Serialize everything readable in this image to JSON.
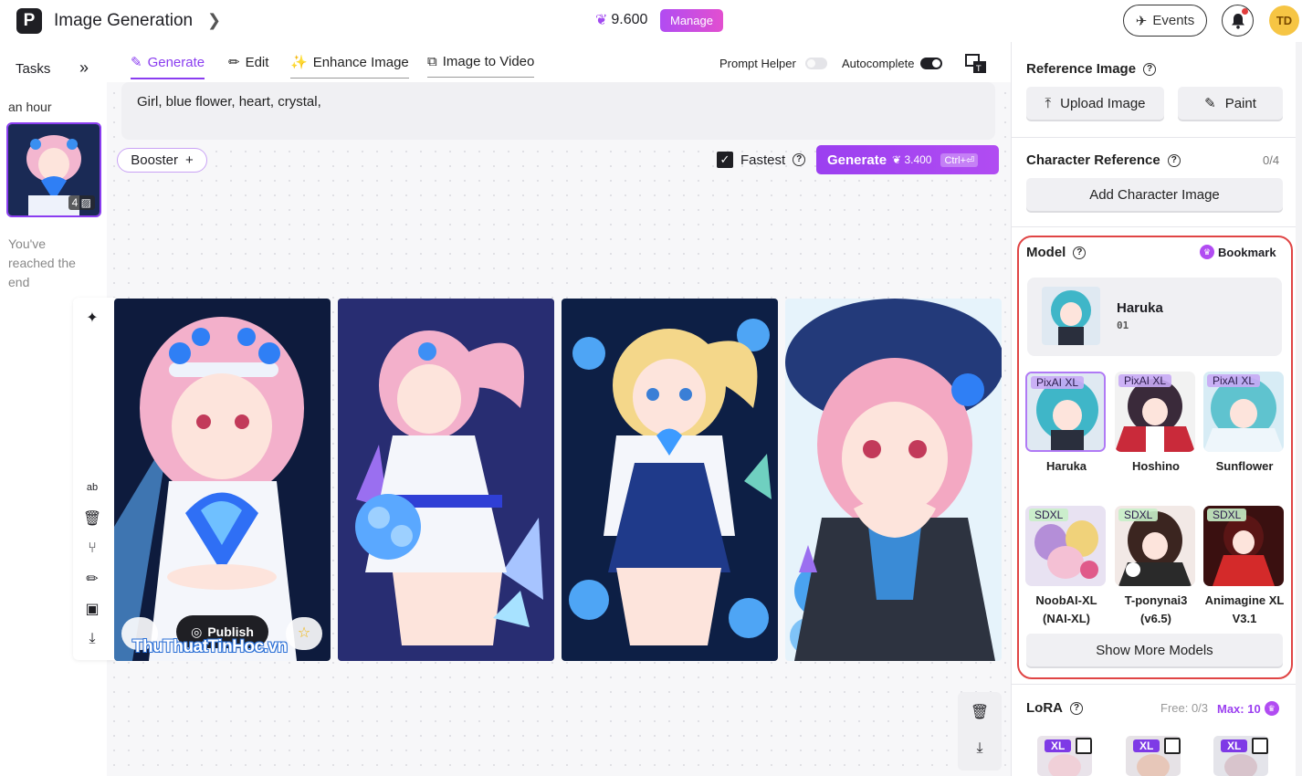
{
  "app": {
    "logo_letter": "P",
    "title": "Image Generation",
    "credits": "9.600",
    "manage_label": "Manage",
    "events_label": "Events",
    "avatar_initials": "TD",
    "accent": "#9b3ff0"
  },
  "tasks": {
    "title": "Tasks",
    "time_label": "an hour",
    "thumb_count": "4",
    "end_text": "You've reached the end"
  },
  "tabs": [
    {
      "label": "Generate",
      "icon": "brush-icon",
      "active": true
    },
    {
      "label": "Edit",
      "icon": "pencil-icon",
      "active": false
    },
    {
      "label": "Enhance Image",
      "icon": "enhance-icon",
      "active": false
    },
    {
      "label": "Image to Video",
      "icon": "video-icon",
      "active": false
    }
  ],
  "toggles": {
    "prompt_helper_label": "Prompt Helper",
    "prompt_helper_on": false,
    "autocomplete_label": "Autocomplete",
    "autocomplete_on": true
  },
  "prompt": {
    "value": "Girl, blue flower, heart, crystal,"
  },
  "booster": {
    "label": "Booster"
  },
  "fastest": {
    "label": "Fastest",
    "checked": true
  },
  "generate": {
    "label": "Generate",
    "cost": "3.400",
    "shortcut": "Ctrl+⏎"
  },
  "image_actions": {
    "publish_label": "Publish",
    "watermark": "ThuThuatTinHoc.vn"
  },
  "right": {
    "reference_title": "Reference Image",
    "upload_label": "Upload Image",
    "paint_label": "Paint",
    "character_title": "Character Reference",
    "character_count": "0/4",
    "add_character_label": "Add Character Image",
    "model_title": "Model",
    "bookmark_label": "Bookmark",
    "current_model": {
      "name": "Haruka",
      "version": "01"
    },
    "models": [
      {
        "tag": "PixAI XL",
        "name": "Haruka"
      },
      {
        "tag": "PixAI XL",
        "name": "Hoshino"
      },
      {
        "tag": "PixAI XL",
        "name": "Sunflower"
      },
      {
        "tag": "SDXL",
        "name": "NoobAI-XL (NAI-XL)"
      },
      {
        "tag": "SDXL",
        "name": "T-ponynai3 (v6.5)"
      },
      {
        "tag": "SDXL",
        "name": "Animagine XL V3.1"
      }
    ],
    "show_more_label": "Show More Models",
    "lora_title": "LoRA",
    "lora_free": "Free: 0/3",
    "lora_max": "Max: 10",
    "lora_tags": [
      "XL",
      "XL",
      "XL"
    ]
  }
}
